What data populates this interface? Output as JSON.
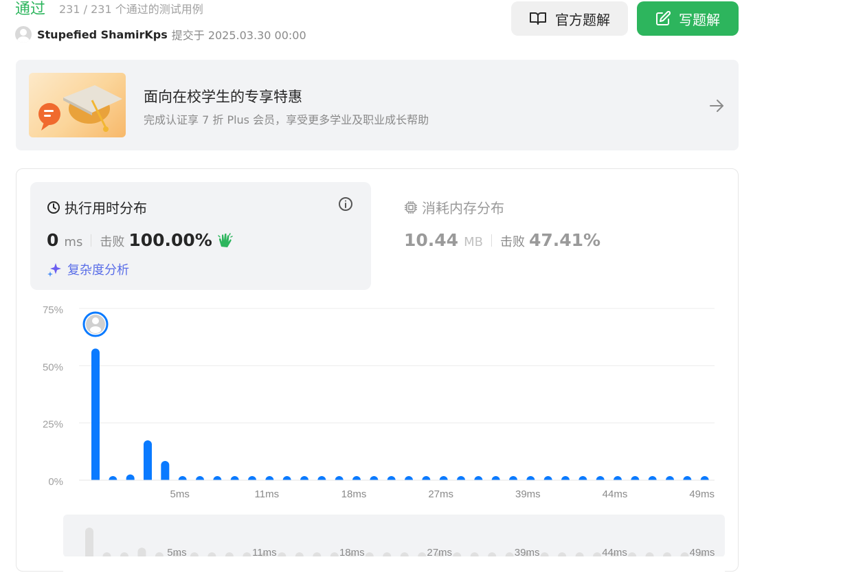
{
  "header": {
    "status": "通过",
    "tests_passed": "231 / 231 个通过的测试用例",
    "username": "Stupefied ShamirKps",
    "submitted_at": "提交于 2025.03.30 00:00",
    "official_solution_label": "官方题解",
    "write_solution_label": "写题解"
  },
  "promo": {
    "title": "面向在校学生的专享特惠",
    "subtitle": "完成认证享 7 折 Plus 会员，享受更多学业及职业成长帮助"
  },
  "runtime": {
    "title": "执行用时分布",
    "value": "0",
    "unit": "ms",
    "beat_label": "击败",
    "beat_value": "100.00%",
    "complexity_label": "复杂度分析"
  },
  "memory": {
    "title": "消耗内存分布",
    "value": "10.44",
    "unit": "MB",
    "beat_label": "击败",
    "beat_value": "47.41%"
  },
  "colors": {
    "accent_green": "#2db55d",
    "bar_blue": "#0a7aff",
    "complexity_purple": "#5a6ee8"
  },
  "chart_data": {
    "type": "bar",
    "y_ticks": [
      "75%",
      "50%",
      "25%",
      "0%"
    ],
    "ylim": [
      0,
      75
    ],
    "x_tick_labels": [
      "5ms",
      "11ms",
      "18ms",
      "27ms",
      "39ms",
      "44ms",
      "49ms"
    ],
    "x_tick_positions": [
      5,
      10,
      15,
      20,
      25,
      30,
      35
    ],
    "values": [
      57.5,
      1.2,
      2.5,
      17.4,
      8.4,
      1.2,
      1.2,
      1.2,
      1.2,
      1.2,
      1.2,
      1.2,
      1.2,
      1.2,
      1.2,
      1.2,
      1.2,
      1.2,
      1.2,
      1.2,
      1.2,
      1.2,
      1.2,
      1.2,
      1.2,
      1.2,
      1.2,
      1.2,
      1.2,
      1.2,
      1.2,
      1.2,
      1.2,
      1.2,
      1.2,
      1.2
    ],
    "highlight_index": 0,
    "grid": true
  }
}
